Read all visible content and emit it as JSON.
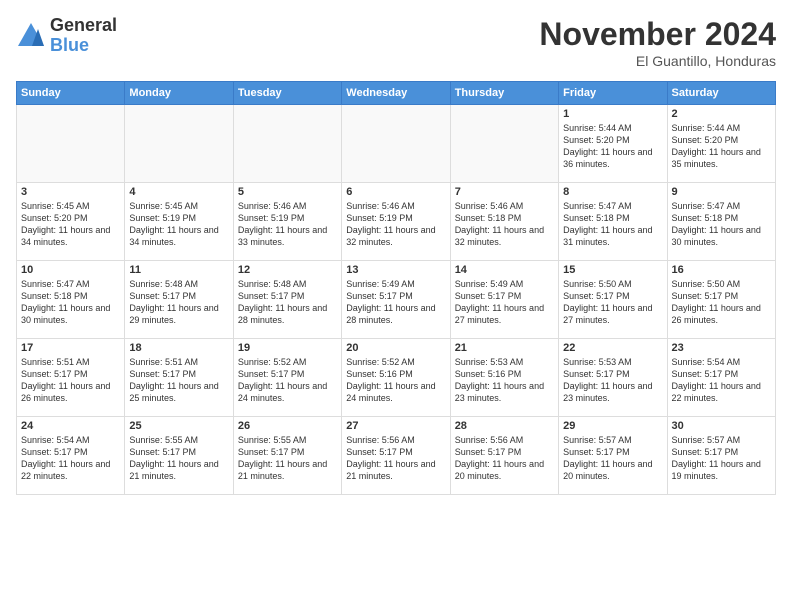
{
  "logo": {
    "general": "General",
    "blue": "Blue"
  },
  "title": "November 2024",
  "location": "El Guantillo, Honduras",
  "weekdays": [
    "Sunday",
    "Monday",
    "Tuesday",
    "Wednesday",
    "Thursday",
    "Friday",
    "Saturday"
  ],
  "weeks": [
    [
      {
        "day": "",
        "info": ""
      },
      {
        "day": "",
        "info": ""
      },
      {
        "day": "",
        "info": ""
      },
      {
        "day": "",
        "info": ""
      },
      {
        "day": "",
        "info": ""
      },
      {
        "day": "1",
        "info": "Sunrise: 5:44 AM\nSunset: 5:20 PM\nDaylight: 11 hours and 36 minutes."
      },
      {
        "day": "2",
        "info": "Sunrise: 5:44 AM\nSunset: 5:20 PM\nDaylight: 11 hours and 35 minutes."
      }
    ],
    [
      {
        "day": "3",
        "info": "Sunrise: 5:45 AM\nSunset: 5:20 PM\nDaylight: 11 hours and 34 minutes."
      },
      {
        "day": "4",
        "info": "Sunrise: 5:45 AM\nSunset: 5:19 PM\nDaylight: 11 hours and 34 minutes."
      },
      {
        "day": "5",
        "info": "Sunrise: 5:46 AM\nSunset: 5:19 PM\nDaylight: 11 hours and 33 minutes."
      },
      {
        "day": "6",
        "info": "Sunrise: 5:46 AM\nSunset: 5:19 PM\nDaylight: 11 hours and 32 minutes."
      },
      {
        "day": "7",
        "info": "Sunrise: 5:46 AM\nSunset: 5:18 PM\nDaylight: 11 hours and 32 minutes."
      },
      {
        "day": "8",
        "info": "Sunrise: 5:47 AM\nSunset: 5:18 PM\nDaylight: 11 hours and 31 minutes."
      },
      {
        "day": "9",
        "info": "Sunrise: 5:47 AM\nSunset: 5:18 PM\nDaylight: 11 hours and 30 minutes."
      }
    ],
    [
      {
        "day": "10",
        "info": "Sunrise: 5:47 AM\nSunset: 5:18 PM\nDaylight: 11 hours and 30 minutes."
      },
      {
        "day": "11",
        "info": "Sunrise: 5:48 AM\nSunset: 5:17 PM\nDaylight: 11 hours and 29 minutes."
      },
      {
        "day": "12",
        "info": "Sunrise: 5:48 AM\nSunset: 5:17 PM\nDaylight: 11 hours and 28 minutes."
      },
      {
        "day": "13",
        "info": "Sunrise: 5:49 AM\nSunset: 5:17 PM\nDaylight: 11 hours and 28 minutes."
      },
      {
        "day": "14",
        "info": "Sunrise: 5:49 AM\nSunset: 5:17 PM\nDaylight: 11 hours and 27 minutes."
      },
      {
        "day": "15",
        "info": "Sunrise: 5:50 AM\nSunset: 5:17 PM\nDaylight: 11 hours and 27 minutes."
      },
      {
        "day": "16",
        "info": "Sunrise: 5:50 AM\nSunset: 5:17 PM\nDaylight: 11 hours and 26 minutes."
      }
    ],
    [
      {
        "day": "17",
        "info": "Sunrise: 5:51 AM\nSunset: 5:17 PM\nDaylight: 11 hours and 26 minutes."
      },
      {
        "day": "18",
        "info": "Sunrise: 5:51 AM\nSunset: 5:17 PM\nDaylight: 11 hours and 25 minutes."
      },
      {
        "day": "19",
        "info": "Sunrise: 5:52 AM\nSunset: 5:17 PM\nDaylight: 11 hours and 24 minutes."
      },
      {
        "day": "20",
        "info": "Sunrise: 5:52 AM\nSunset: 5:16 PM\nDaylight: 11 hours and 24 minutes."
      },
      {
        "day": "21",
        "info": "Sunrise: 5:53 AM\nSunset: 5:16 PM\nDaylight: 11 hours and 23 minutes."
      },
      {
        "day": "22",
        "info": "Sunrise: 5:53 AM\nSunset: 5:17 PM\nDaylight: 11 hours and 23 minutes."
      },
      {
        "day": "23",
        "info": "Sunrise: 5:54 AM\nSunset: 5:17 PM\nDaylight: 11 hours and 22 minutes."
      }
    ],
    [
      {
        "day": "24",
        "info": "Sunrise: 5:54 AM\nSunset: 5:17 PM\nDaylight: 11 hours and 22 minutes."
      },
      {
        "day": "25",
        "info": "Sunrise: 5:55 AM\nSunset: 5:17 PM\nDaylight: 11 hours and 21 minutes."
      },
      {
        "day": "26",
        "info": "Sunrise: 5:55 AM\nSunset: 5:17 PM\nDaylight: 11 hours and 21 minutes."
      },
      {
        "day": "27",
        "info": "Sunrise: 5:56 AM\nSunset: 5:17 PM\nDaylight: 11 hours and 21 minutes."
      },
      {
        "day": "28",
        "info": "Sunrise: 5:56 AM\nSunset: 5:17 PM\nDaylight: 11 hours and 20 minutes."
      },
      {
        "day": "29",
        "info": "Sunrise: 5:57 AM\nSunset: 5:17 PM\nDaylight: 11 hours and 20 minutes."
      },
      {
        "day": "30",
        "info": "Sunrise: 5:57 AM\nSunset: 5:17 PM\nDaylight: 11 hours and 19 minutes."
      }
    ]
  ]
}
